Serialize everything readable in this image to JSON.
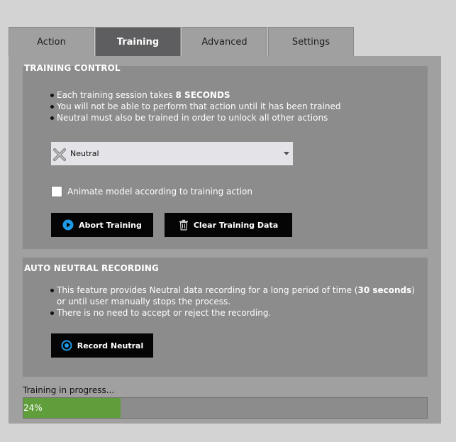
{
  "tabs": [
    {
      "label": "Action",
      "active": false
    },
    {
      "label": "Training",
      "active": true
    },
    {
      "label": "Advanced",
      "active": false
    },
    {
      "label": "Settings",
      "active": false
    }
  ],
  "training_control": {
    "title": "TRAINING CONTROL",
    "bullets": {
      "b1_prefix": "Each training session takes ",
      "b1_bold": "8 SECONDS",
      "b2": "You will not be able to perform that action until it has been trained",
      "b3": "Neutral must also be trained in order to unlock all other actions"
    },
    "dropdown": {
      "selected": "Neutral",
      "icon": "neutral-cross-icon"
    },
    "checkbox": {
      "label": "Animate model according to training action",
      "checked": false
    },
    "abort_button": {
      "label": "Abort Training",
      "icon": "play-circle-icon"
    },
    "clear_button": {
      "label": "Clear Training Data",
      "icon": "trash-icon"
    }
  },
  "auto_neutral": {
    "title": "AUTO NEUTRAL RECORDING",
    "bullets": {
      "b1_prefix": "This feature provides Neutral data recording for a long period of time (",
      "b1_bold": "30 seconds",
      "b1_suffix": ") or until user manually stops the process.",
      "b2": "There is no need to accept or reject the recording."
    },
    "record_button": {
      "label": "Record Neutral",
      "icon": "record-circle-icon"
    }
  },
  "progress": {
    "label": "Training in progress...",
    "percent": 24,
    "percent_text": "24%",
    "color": "#5f9e3a"
  },
  "colors": {
    "background": "#d3d3d3",
    "panel": "#a0a0a0",
    "section": "#8c8c8c",
    "active_tab": "#5e5e60",
    "button": "#050505",
    "accent_blue": "#1e9be8"
  }
}
